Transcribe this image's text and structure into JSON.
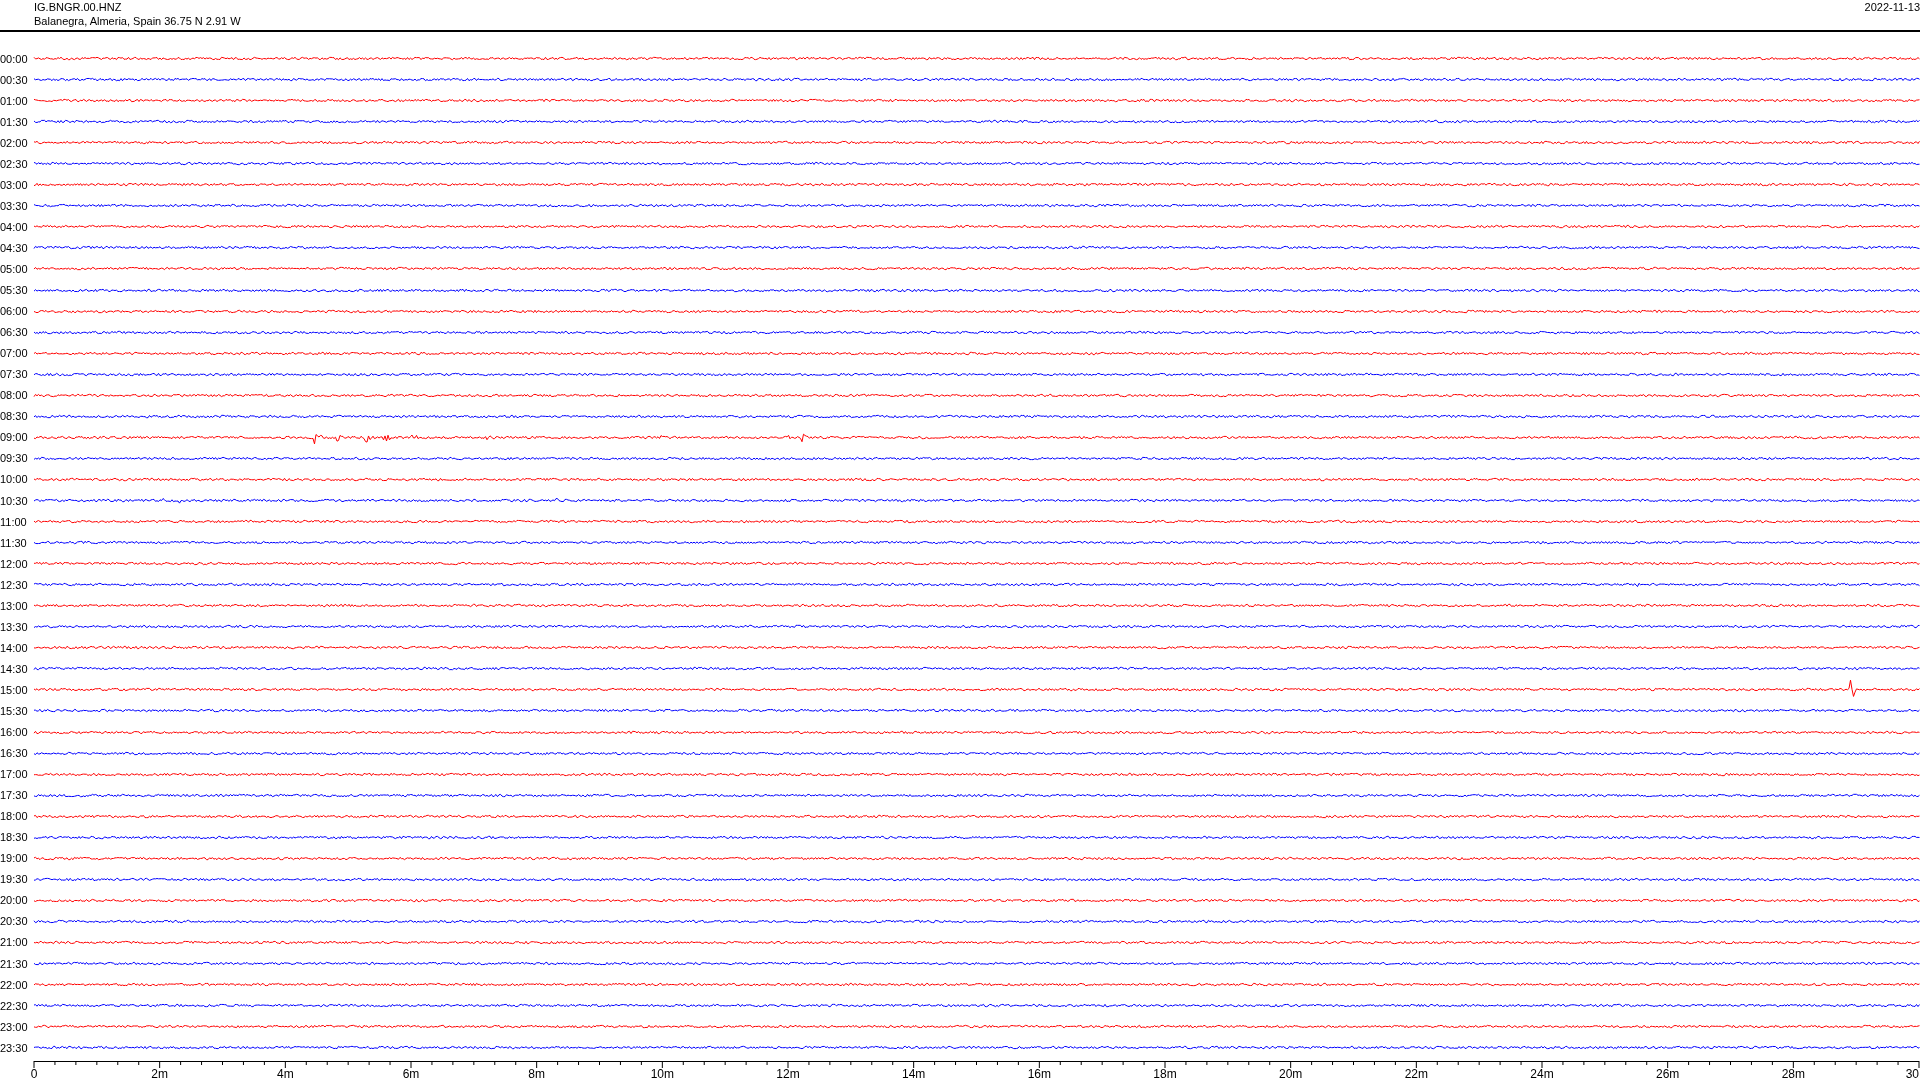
{
  "header": {
    "station": "IG.BNGR.00.HNZ",
    "location": "Balanegra, Almeria, Spain  36.75 N 2.91 W",
    "date": "2022-11-13"
  },
  "rows": [
    {
      "label": "00:00",
      "color": "#ff0000"
    },
    {
      "label": "00:30",
      "color": "#0000ff"
    },
    {
      "label": "01:00",
      "color": "#ff0000"
    },
    {
      "label": "01:30",
      "color": "#0000ff"
    },
    {
      "label": "02:00",
      "color": "#ff0000"
    },
    {
      "label": "02:30",
      "color": "#0000ff"
    },
    {
      "label": "03:00",
      "color": "#ff0000"
    },
    {
      "label": "03:30",
      "color": "#0000ff"
    },
    {
      "label": "04:00",
      "color": "#ff0000"
    },
    {
      "label": "04:30",
      "color": "#0000ff"
    },
    {
      "label": "05:00",
      "color": "#ff0000"
    },
    {
      "label": "05:30",
      "color": "#0000ff"
    },
    {
      "label": "06:00",
      "color": "#ff0000"
    },
    {
      "label": "06:30",
      "color": "#0000ff"
    },
    {
      "label": "07:00",
      "color": "#ff0000"
    },
    {
      "label": "07:30",
      "color": "#0000ff"
    },
    {
      "label": "08:00",
      "color": "#ff0000"
    },
    {
      "label": "08:30",
      "color": "#0000ff"
    },
    {
      "label": "09:00",
      "color": "#ff0000"
    },
    {
      "label": "09:30",
      "color": "#0000ff"
    },
    {
      "label": "10:00",
      "color": "#ff0000"
    },
    {
      "label": "10:30",
      "color": "#0000ff"
    },
    {
      "label": "11:00",
      "color": "#ff0000"
    },
    {
      "label": "11:30",
      "color": "#0000ff"
    },
    {
      "label": "12:00",
      "color": "#ff0000"
    },
    {
      "label": "12:30",
      "color": "#0000ff"
    },
    {
      "label": "13:00",
      "color": "#ff0000"
    },
    {
      "label": "13:30",
      "color": "#0000ff"
    },
    {
      "label": "14:00",
      "color": "#ff0000"
    },
    {
      "label": "14:30",
      "color": "#0000ff"
    },
    {
      "label": "15:00",
      "color": "#ff0000"
    },
    {
      "label": "15:30",
      "color": "#0000ff"
    },
    {
      "label": "16:00",
      "color": "#ff0000"
    },
    {
      "label": "16:30",
      "color": "#0000ff"
    },
    {
      "label": "17:00",
      "color": "#ff0000"
    },
    {
      "label": "17:30",
      "color": "#0000ff"
    },
    {
      "label": "18:00",
      "color": "#ff0000"
    },
    {
      "label": "18:30",
      "color": "#0000ff"
    },
    {
      "label": "19:00",
      "color": "#ff0000"
    },
    {
      "label": "19:30",
      "color": "#0000ff"
    },
    {
      "label": "20:00",
      "color": "#ff0000"
    },
    {
      "label": "20:30",
      "color": "#0000ff"
    },
    {
      "label": "21:00",
      "color": "#ff0000"
    },
    {
      "label": "21:30",
      "color": "#0000ff"
    },
    {
      "label": "22:00",
      "color": "#ff0000"
    },
    {
      "label": "22:30",
      "color": "#0000ff"
    },
    {
      "label": "23:00",
      "color": "#ff0000"
    },
    {
      "label": "23:30",
      "color": "#0000ff"
    }
  ],
  "axis": {
    "labels": [
      "0",
      "2m",
      "4m",
      "6m",
      "8m",
      "10m",
      "12m",
      "14m",
      "16m",
      "18m",
      "20m",
      "22m",
      "24m",
      "26m",
      "28m",
      "30"
    ]
  }
}
